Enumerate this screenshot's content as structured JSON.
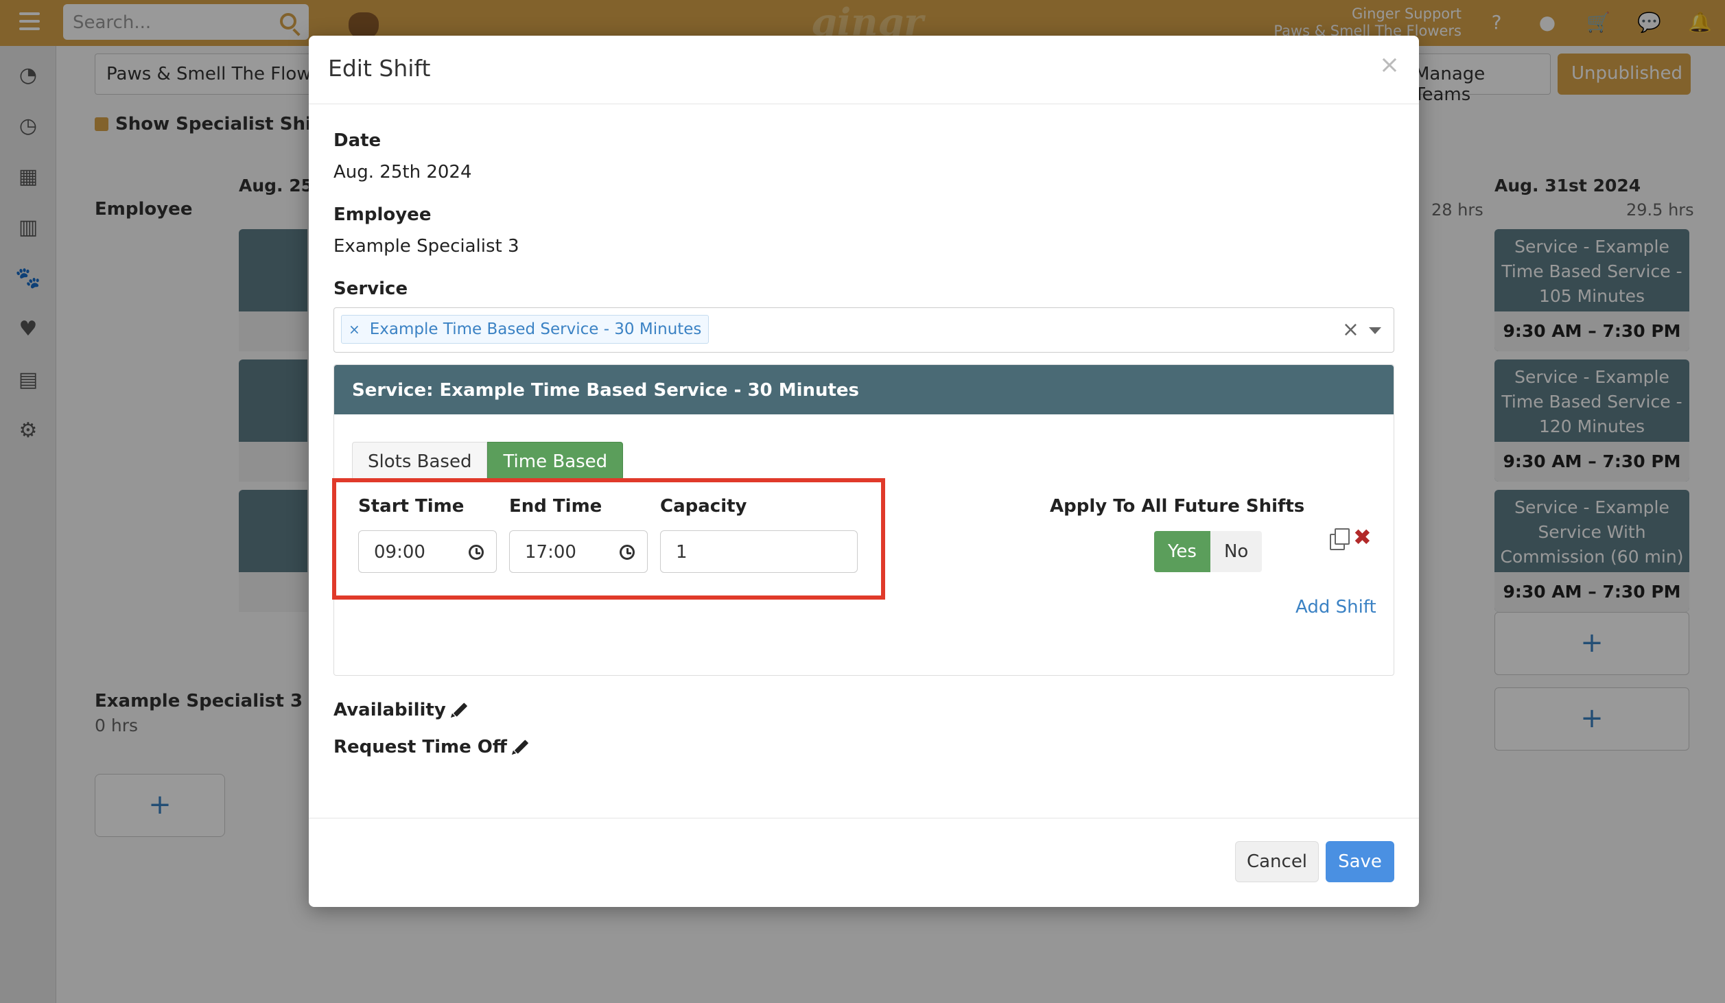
{
  "app": {
    "search_placeholder": "Search...",
    "brand": "gingr",
    "user_name": "Ginger Support",
    "user_location": "Paws & Smell The Flowers"
  },
  "schedule": {
    "location_select": "Paws & Smell The Flowe...",
    "show_specialist_shifts": "Show Specialist Shifts",
    "manage_teams": "Manage Teams",
    "publish_status": "Unpublished",
    "employee_header": "Employee",
    "day_first": "Aug. 25th",
    "day_last": "Aug. 31st 2024",
    "hrs_prev_col": "28 hrs",
    "hrs_last_col": "29.5 hrs",
    "cards": [
      {
        "label": "Service - Example Time Based Service - 105 Minutes",
        "time": "9:30 AM – 7:30 PM"
      },
      {
        "label": "Service - Example Time Based Service - 120 Minutes",
        "time": "9:30 AM – 7:30 PM"
      },
      {
        "label": "Service - Example Service With Commission (60 min)",
        "time": "9:30 AM – 7:30 PM"
      }
    ],
    "employee2_name": "Example Specialist 3",
    "employee2_hours": "0 hrs",
    "add_label": "+"
  },
  "modal": {
    "title": "Edit Shift",
    "close": "×",
    "date_label": "Date",
    "date_value": "Aug. 25th 2024",
    "employee_label": "Employee",
    "employee_value": "Example Specialist 3",
    "service_label": "Service",
    "service_chip": "Example Time Based Service - 30 Minutes",
    "service_chip_remove": "×",
    "service_clear": "×",
    "service_panel_title": "Service: Example Time Based Service - 30 Minutes",
    "tabs": [
      {
        "label": "Slots Based",
        "active": false
      },
      {
        "label": "Time Based",
        "active": true
      }
    ],
    "start_time_label": "Start Time",
    "start_time_value": "09:00",
    "end_time_label": "End Time",
    "end_time_value": "17:00",
    "capacity_label": "Capacity",
    "capacity_value": "1",
    "apply_future_label": "Apply To All Future Shifts",
    "yes_label": "Yes",
    "no_label": "No",
    "delete_glyph": "✖",
    "add_shift": "Add Shift",
    "availability_label": "Availability",
    "request_time_off_label": "Request Time Off",
    "cancel": "Cancel",
    "save": "Save"
  },
  "colors": {
    "brand_orange": "#d9a34a",
    "panel_header": "#4a6a75",
    "active_green": "#5b9e5b",
    "save_blue": "#4a90e2",
    "highlight_red": "#e03a2a",
    "link_blue": "#3b82c4"
  }
}
